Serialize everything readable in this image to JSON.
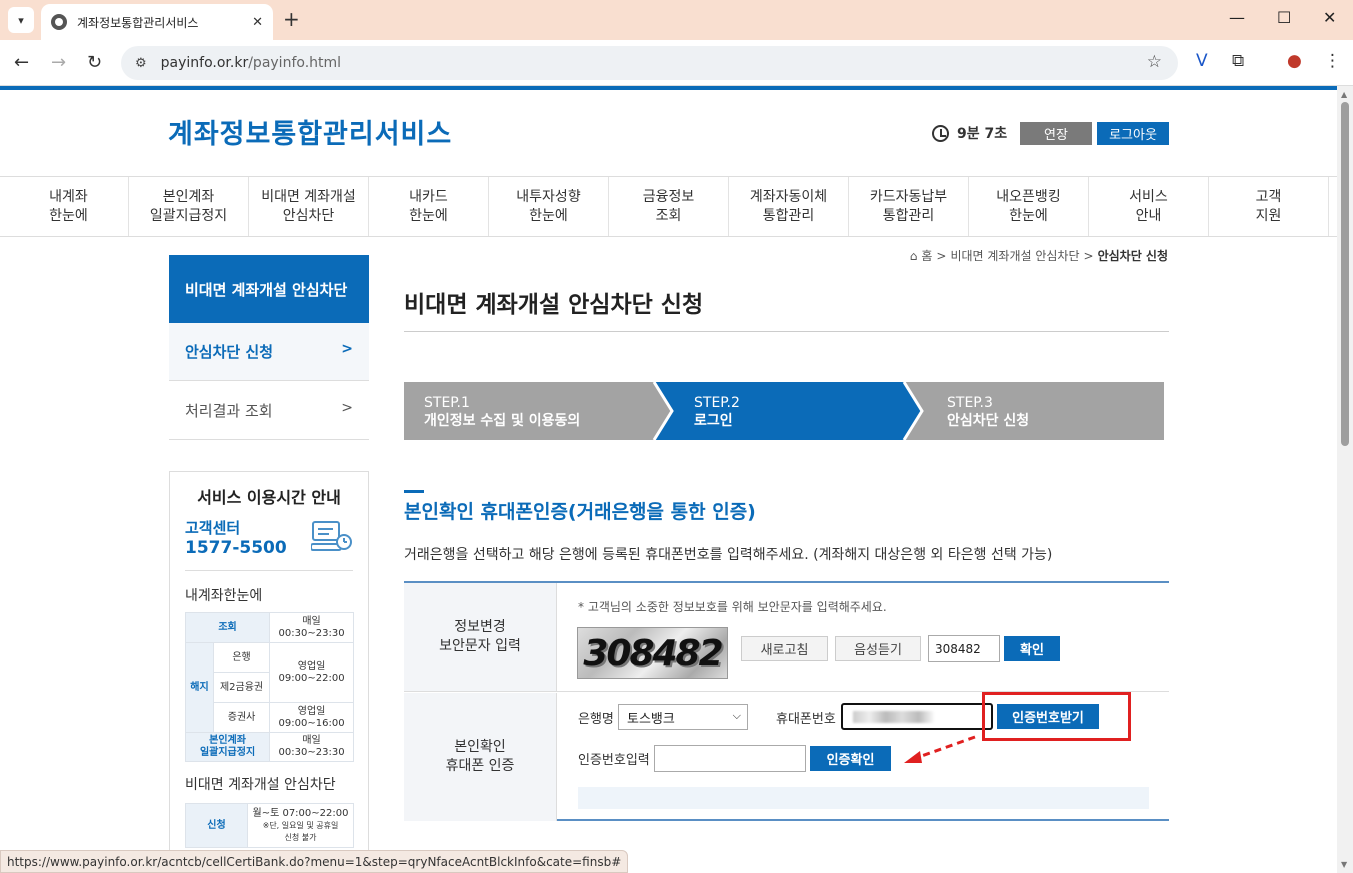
{
  "browser": {
    "tab_title": "계좌정보통합관리서비스",
    "tab_close": "✕",
    "new_tab": "+",
    "url_domain": "payinfo.or.kr",
    "url_path": "/payinfo.html",
    "status_url": "https://www.payinfo.or.kr/acntcb/cellCertiBank.do?menu=1&step=qryNfaceAcntBlckInfo&cate=finsb#"
  },
  "header": {
    "logo": "계좌정보통합관리서비스",
    "timer": "9분 7초",
    "extend": "연장",
    "logout": "로그아웃"
  },
  "gnb": [
    {
      "label": "내계좌\n한눈에"
    },
    {
      "label": "본인계좌\n일괄지급정지"
    },
    {
      "label": "비대면 계좌개설\n안심차단"
    },
    {
      "label": "내카드\n한눈에"
    },
    {
      "label": "내투자성향\n한눈에"
    },
    {
      "label": "금융정보\n조회"
    },
    {
      "label": "계좌자동이체\n통합관리"
    },
    {
      "label": "카드자동납부\n통합관리"
    },
    {
      "label": "내오픈뱅킹\n한눈에"
    },
    {
      "label": "서비스\n안내"
    },
    {
      "label": "고객\n지원"
    }
  ],
  "breadcrumb": {
    "home": "홈",
    "sep": ">",
    "level1": "비대면 계좌개설 안심차단",
    "current": "안심차단 신청"
  },
  "lnb": {
    "title": "비대면 계좌개설 안심차단",
    "items": [
      {
        "label": "안심차단 신청",
        "arrow": ">"
      },
      {
        "label": "처리결과 조회",
        "arrow": ">"
      }
    ]
  },
  "service_box": {
    "title": "서비스 이용시간 안내",
    "cc_label": "고객센터",
    "cc_phone": "1577-5500",
    "sub1": "내계좌한눈에",
    "sub2": "비대면 계좌개설 안심차단",
    "table1": {
      "row_query_h": "조회",
      "row_query_v": "매일\n00:30~23:30",
      "row_cancel_h": "해지",
      "bank": "은행",
      "bank_time": "영업일\n09:00~22:00",
      "fin2": "제2금융권",
      "sec": "증권사",
      "sec_time": "영업일\n09:00~16:00",
      "stop_h": "본인계좌\n일괄지급정지",
      "stop_v": "매일\n00:30~23:30"
    },
    "table2": {
      "apply_h": "신청",
      "apply_v1": "월~토 07:00~22:00",
      "apply_v2": "※단, 일요일 및 공휴일\n신청 불가"
    }
  },
  "main": {
    "page_title": "비대면 계좌개설 안심차단 신청",
    "steps": [
      {
        "num": "STEP.1",
        "label": "개인정보 수집 및 이용동의"
      },
      {
        "num": "STEP.2",
        "label": "로그인"
      },
      {
        "num": "STEP.3",
        "label": "안심차단 신청"
      }
    ],
    "section_title": "본인확인 휴대폰인증(거래은행을 통한 인증)",
    "section_desc": "거래은행을 선택하고 해당 은행에 등록된 휴대폰번호를 입력해주세요. (계좌해지 대상은행 외 타은행 선택 가능)",
    "row1_th": "정보변경\n보안문자 입력",
    "notice": "* 고객님의 소중한 정보보호를 위해 보안문자를 입력해주세요.",
    "captcha_text": "308482",
    "refresh": "새로고침",
    "audio": "음성듣기",
    "captcha_input": "308482",
    "confirm": "확인",
    "row2_th": "본인확인\n휴대폰 인증",
    "bank_label": "은행명",
    "bank_value": "토스뱅크",
    "phone_label": "휴대폰번호",
    "get_code": "인증번호받기",
    "code_label": "인증번호입력",
    "verify": "인증확인"
  },
  "colors": {
    "brand_blue": "#0b6bb8",
    "step_gray": "#a3a3a3",
    "highlight_red": "#e02020"
  }
}
